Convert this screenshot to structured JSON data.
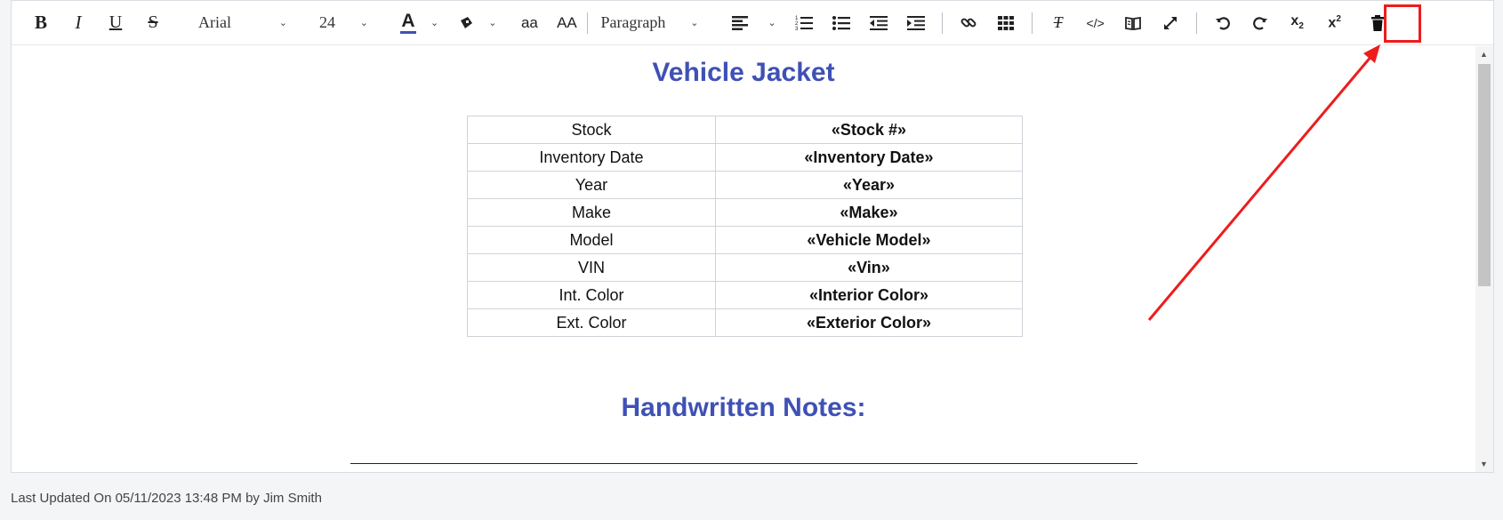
{
  "toolbar": {
    "bold": "B",
    "italic": "I",
    "underline": "U",
    "strikethrough": "S",
    "font_family": "Arial",
    "font_size": "24",
    "text_color_letter": "A",
    "lowercase": "aa",
    "uppercase": "AA",
    "block_format": "Paragraph",
    "clear_format": "T",
    "code": "</>",
    "subscript_base": "x",
    "subscript_mark": "2",
    "superscript_base": "x",
    "superscript_mark": "2",
    "icons": [
      "bold-icon",
      "italic-icon",
      "underline-icon",
      "strikethrough-icon",
      "text-color-icon",
      "highlight-color-icon",
      "align-left-icon",
      "ordered-list-icon",
      "unordered-list-icon",
      "outdent-icon",
      "indent-icon",
      "link-icon",
      "table-icon",
      "clear-format-icon",
      "code-view-icon",
      "preview-icon",
      "fullscreen-icon",
      "undo-icon",
      "redo-icon",
      "subscript-icon",
      "superscript-icon",
      "trash-icon"
    ],
    "accent_color": "#3f51b5",
    "text_color_underline": "#3f51b5"
  },
  "document": {
    "title": "Vehicle Jacket",
    "rows": [
      {
        "label": "Stock",
        "value": "«Stock #»"
      },
      {
        "label": "Inventory Date",
        "value": "«Inventory Date»"
      },
      {
        "label": "Year",
        "value": "«Year»"
      },
      {
        "label": "Make",
        "value": "«Make»"
      },
      {
        "label": "Model",
        "value": "«Vehicle Model»"
      },
      {
        "label": "VIN",
        "value": "«Vin»"
      },
      {
        "label": "Int. Color",
        "value": "«Interior Color»"
      },
      {
        "label": "Ext. Color",
        "value": "«Exterior Color»"
      }
    ],
    "notes_heading": "Handwritten Notes:",
    "heading_color": "#3f51b5"
  },
  "annotation": {
    "highlight_color": "#ee1c1c",
    "target": "trash-icon"
  },
  "footer": {
    "status": "Last Updated On 05/11/2023 13:48 PM by Jim Smith"
  }
}
